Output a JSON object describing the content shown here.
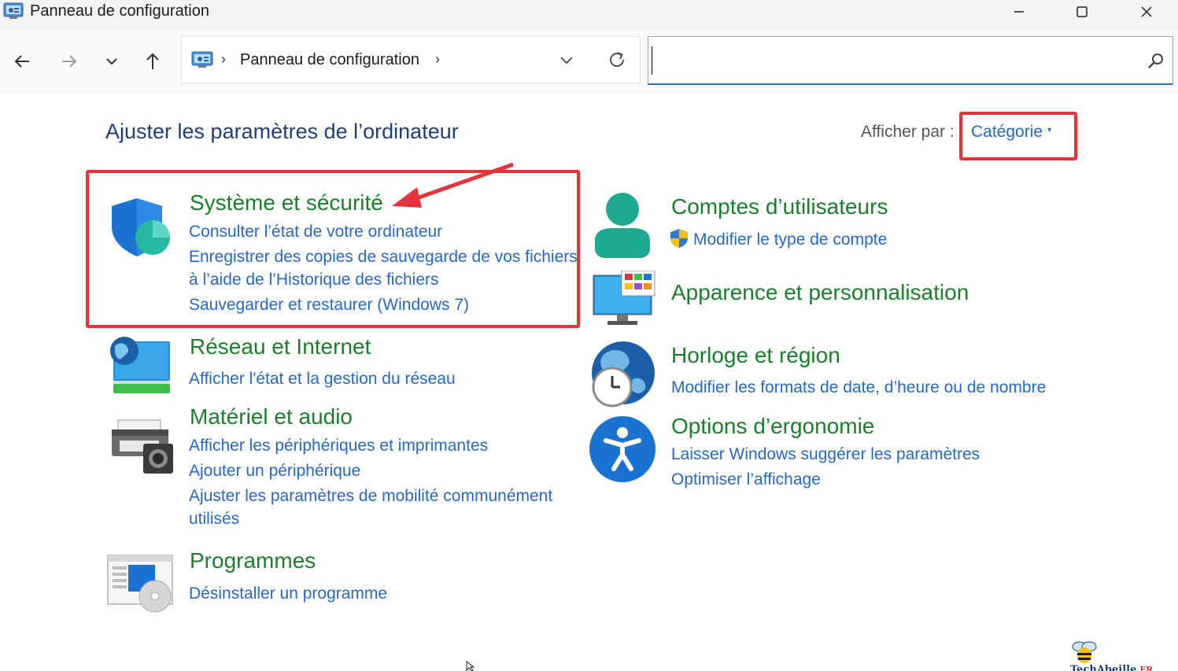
{
  "window": {
    "title": "Panneau de configuration"
  },
  "nav": {
    "breadcrumb": "Panneau de configuration",
    "search_placeholder": ""
  },
  "content": {
    "page_title": "Ajuster les paramètres de l’ordinateur",
    "view_by_label": "Afficher par :",
    "view_by_value": "Catégorie"
  },
  "categories": {
    "system": {
      "title": "Système et sécurité",
      "links": [
        "Consulter l’état de votre ordinateur",
        "Enregistrer des copies de sauvegarde de vos fichiers",
        "à l’aide de l’Historique des fichiers",
        "Sauvegarder et restaurer (Windows 7)"
      ]
    },
    "network": {
      "title": "Réseau et Internet",
      "links": [
        "Afficher l'état et la gestion du réseau"
      ]
    },
    "hardware": {
      "title": "Matériel et audio",
      "links": [
        "Afficher les périphériques et imprimantes",
        "Ajouter un périphérique",
        "Ajuster les paramètres de mobilité communément",
        "utilisés"
      ]
    },
    "programs": {
      "title": "Programmes",
      "links": [
        "Désinstaller un programme"
      ]
    },
    "accounts": {
      "title": "Comptes d’utilisateurs",
      "links": [
        "Modifier le type de compte"
      ]
    },
    "appearance": {
      "title": "Apparence et personnalisation",
      "links": []
    },
    "clock": {
      "title": "Horloge et région",
      "links": [
        "Modifier les formats de date, d’heure ou de nombre"
      ]
    },
    "ease": {
      "title": "Options d’ergonomie",
      "links": [
        "Laisser Windows suggérer les paramètres",
        "Optimiser l’affichage"
      ]
    }
  },
  "watermark": {
    "name": "TechAbeille",
    "suffix": ".FR"
  },
  "colors": {
    "category_title": "#1a7f2a",
    "link": "#2468c8",
    "page_title": "#1f3f77",
    "annotation_red": "#e2343a"
  }
}
